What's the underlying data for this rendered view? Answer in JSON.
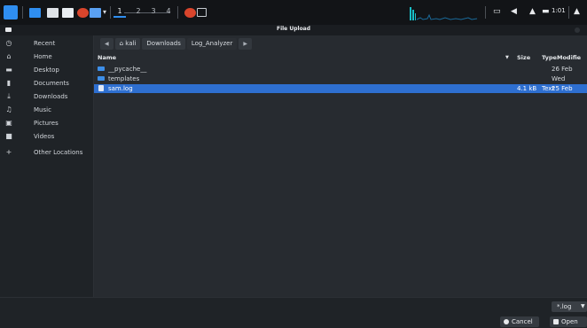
{
  "taskbar": {
    "workspaces": [
      "1",
      "2",
      "3",
      "4"
    ],
    "clock": "1:01"
  },
  "dialog": {
    "title": "File Upload",
    "sidebar": [
      {
        "label": "Recent",
        "icon": "clock-icon"
      },
      {
        "label": "Home",
        "icon": "home-icon"
      },
      {
        "label": "Desktop",
        "icon": "desktop-icon"
      },
      {
        "label": "Documents",
        "icon": "document-icon"
      },
      {
        "label": "Downloads",
        "icon": "download-icon"
      },
      {
        "label": "Music",
        "icon": "music-icon"
      },
      {
        "label": "Pictures",
        "icon": "picture-icon"
      },
      {
        "label": "Videos",
        "icon": "video-icon"
      },
      {
        "label": "Other Locations",
        "icon": "plus-icon"
      }
    ],
    "breadcrumb": [
      "kali",
      "Downloads",
      "Log_Analyzer"
    ],
    "columns": {
      "name": "Name",
      "size": "Size",
      "type": "Type",
      "modified": "Modifie"
    },
    "rows": [
      {
        "name": "__pycache__",
        "size": "",
        "type": "",
        "modified": "26 Feb",
        "kind": "folder"
      },
      {
        "name": "templates",
        "size": "",
        "type": "",
        "modified": "Wed",
        "kind": "folder"
      },
      {
        "name": "sam.log",
        "size": "4.1 kB",
        "type": "Text",
        "modified": "25 Feb",
        "kind": "file",
        "selected": true
      }
    ],
    "filter": "*.log",
    "cancel": "Cancel",
    "open": "Open"
  }
}
